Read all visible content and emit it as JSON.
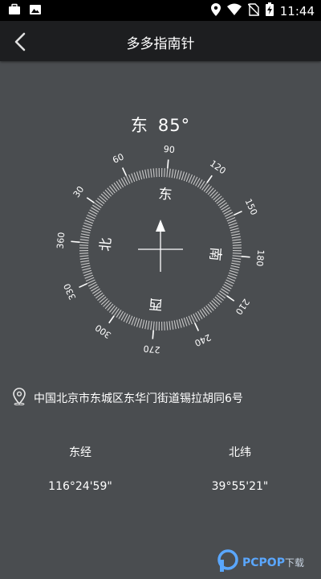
{
  "status_bar": {
    "time": "11:44",
    "left_icons": [
      "briefcase-icon",
      "image-icon"
    ],
    "right_icons": [
      "location-pin-icon",
      "wifi-icon",
      "no-sim-icon",
      "battery-charging-icon"
    ]
  },
  "header": {
    "back_icon": "chevron-left-icon",
    "title": "多多指南针"
  },
  "compass": {
    "direction": "东",
    "degree": "85°",
    "heading_value": 85,
    "degree_labels": [
      "90",
      "120",
      "150",
      "180",
      "210",
      "240",
      "270",
      "300",
      "330",
      "360",
      "30",
      "60"
    ],
    "cardinals": {
      "north": "北",
      "east": "东",
      "south": "南",
      "west": "西"
    }
  },
  "location": {
    "icon": "location-outline-icon",
    "address": "中国北京市东城区东华门街道锡拉胡同6号"
  },
  "coords": {
    "longitude_label": "东经",
    "longitude_value": "116°24'59\"",
    "latitude_label": "北纬",
    "latitude_value": "39°55'21\""
  },
  "watermark": {
    "brand": "PCPOP",
    "suffix": "下载"
  },
  "colors": {
    "background": "#4a4d50",
    "header": "#1d1e20",
    "status_bar": "#000000",
    "ring": "#c9c9c9",
    "watermark": "#5aa7ff"
  }
}
